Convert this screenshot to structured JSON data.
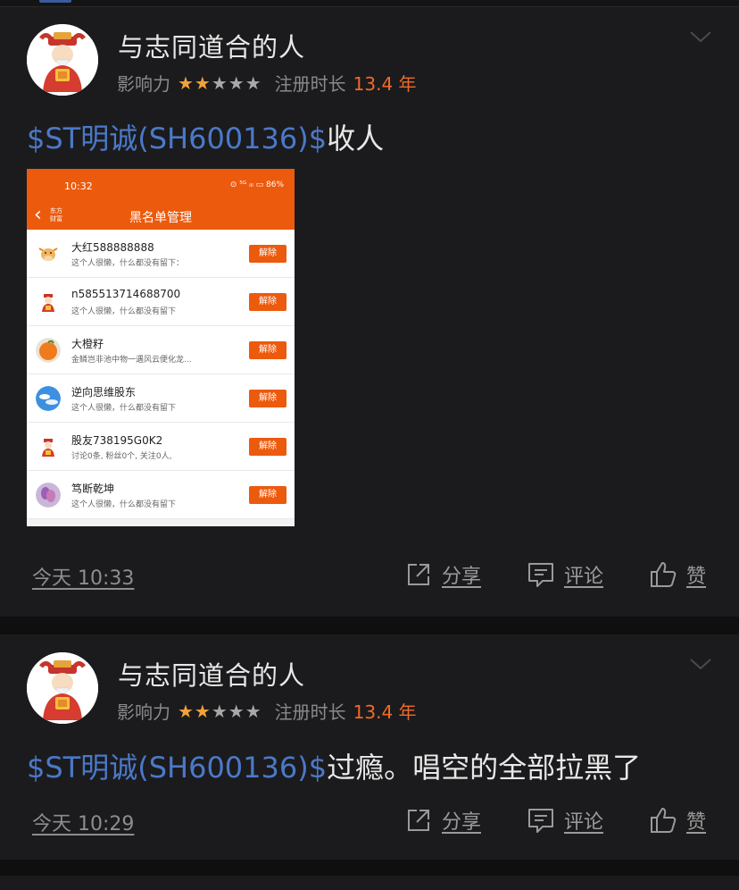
{
  "colors": {
    "background": "#0f0f0f",
    "card": "#1b1b1d",
    "stock_link": "#4b79c8",
    "accent_orange": "#f06a28",
    "star": "#f2a23a",
    "screenshot_header": "#ec5a0e"
  },
  "posts": [
    {
      "username": "与志同道合的人",
      "influence_label": "影响力",
      "stars_filled": 2,
      "stars_total": 5,
      "duration_label": "注册时长",
      "duration_value": "13.4 年",
      "stock": "$ST明诚(SH600136)$",
      "text": "收人",
      "time": "今天 10:33",
      "share_label": "分享",
      "comment_label": "评论",
      "like_label": "赞",
      "attached_image": {
        "status_time": "10:32",
        "status_right": "⊙ ⁵ᴳ ᵢₗₗ ▭ 86%",
        "app_label": "东方财富",
        "title": "黑名单管理",
        "rows": [
          {
            "name": "大红588888888",
            "desc": "这个人很懒，什么都没有留下：",
            "button": "解除",
            "avatar": "cow"
          },
          {
            "name": "n585513714688700",
            "desc": "这个人很懒，什么都没有留下",
            "button": "解除",
            "avatar": "fortune"
          },
          {
            "name": "大橙籽",
            "desc": "金鳞岂非池中物一遇风云便化龙...",
            "button": "解除",
            "avatar": "orange"
          },
          {
            "name": "逆向思维股东",
            "desc": "这个人很懒，什么都没有留下",
            "button": "解除",
            "avatar": "sky"
          },
          {
            "name": "股友738195G0K2",
            "desc": "讨论0条, 粉丝0个, 关注0人,",
            "button": "解除",
            "avatar": "fortune"
          },
          {
            "name": "笃断乾坤",
            "desc": "这个人很懒，什么都没有留下",
            "button": "解除",
            "avatar": "flower"
          }
        ]
      }
    },
    {
      "username": "与志同道合的人",
      "influence_label": "影响力",
      "stars_filled": 2,
      "stars_total": 5,
      "duration_label": "注册时长",
      "duration_value": "13.4 年",
      "stock": "$ST明诚(SH600136)$",
      "text": "过瘾。唱空的全部拉黑了",
      "time": "今天 10:29",
      "share_label": "分享",
      "comment_label": "评论",
      "like_label": "赞"
    }
  ]
}
